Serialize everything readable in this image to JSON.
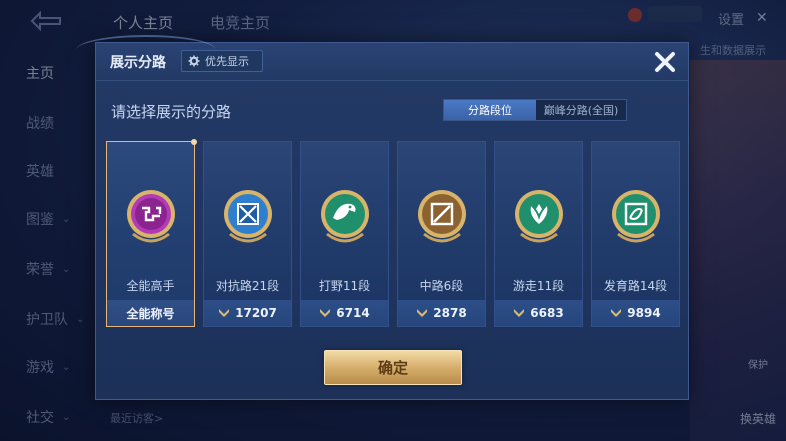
{
  "background": {
    "top_tabs": [
      "个人主页",
      "电竞主页"
    ],
    "settings_label": "设置",
    "right_label": "生和数据展示",
    "side_nav": [
      {
        "label": "主页",
        "active": true,
        "chevron": false
      },
      {
        "label": "战绩",
        "active": false,
        "chevron": false
      },
      {
        "label": "英雄",
        "active": false,
        "chevron": false
      },
      {
        "label": "图鉴",
        "active": false,
        "chevron": true
      },
      {
        "label": "荣誉",
        "active": false,
        "chevron": true
      },
      {
        "label": "护卫队",
        "active": false,
        "chevron": true
      },
      {
        "label": "游戏",
        "active": false,
        "chevron": true
      },
      {
        "label": "社交",
        "active": false,
        "chevron": true
      }
    ],
    "bottom_recent": "最近访客>",
    "right_mid_label": "保护",
    "right_bottom_label": "换英雄"
  },
  "dialog": {
    "title": "展示分路",
    "priority_button": "优先显示",
    "subtitle": "请选择展示的分路",
    "toggle": {
      "left": "分路段位",
      "right": "巅峰分路(全国)",
      "selected": "left"
    },
    "cards": [
      {
        "name": "全能高手",
        "footer": "全能称号",
        "selected": true,
        "emblem": "omni-emblem-icon",
        "color": "#b23bb5",
        "has_arrow": false
      },
      {
        "name": "对抗路21段",
        "footer": "17207",
        "selected": false,
        "emblem": "clash-lane-emblem-icon",
        "color": "#3a8fd8",
        "has_arrow": true
      },
      {
        "name": "打野11段",
        "footer": "6714",
        "selected": false,
        "emblem": "jungle-emblem-icon",
        "color": "#2aa17a",
        "has_arrow": true
      },
      {
        "name": "中路6段",
        "footer": "2878",
        "selected": false,
        "emblem": "mid-lane-emblem-icon",
        "color": "#a0783e",
        "has_arrow": true
      },
      {
        "name": "游走11段",
        "footer": "6683",
        "selected": false,
        "emblem": "roam-emblem-icon",
        "color": "#2aa17a",
        "has_arrow": true
      },
      {
        "name": "发育路14段",
        "footer": "9894",
        "selected": false,
        "emblem": "farm-lane-emblem-icon",
        "color": "#2aa17a",
        "has_arrow": true
      }
    ],
    "confirm_button": "确定"
  }
}
